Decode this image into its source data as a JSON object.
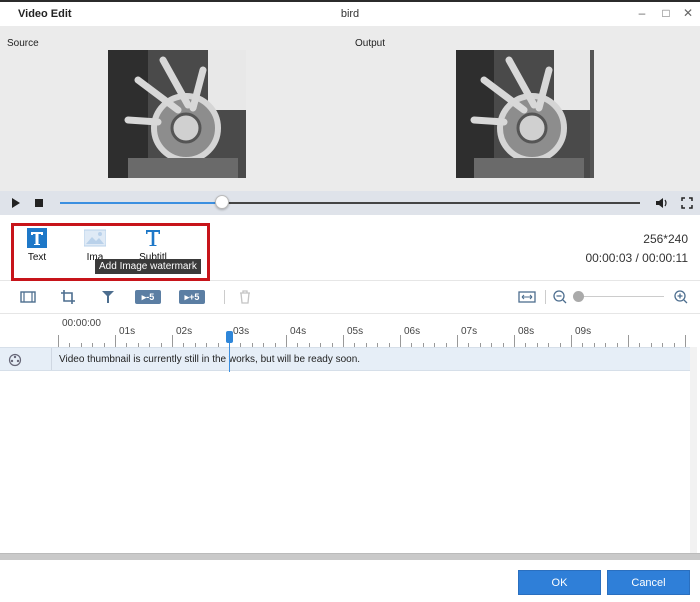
{
  "window": {
    "app_title": "Video Edit",
    "file_name": "bird",
    "minimize_icon": "minimize-icon",
    "maximize_icon": "maximize-icon",
    "close_icon": "close-icon"
  },
  "preview": {
    "source_label": "Source",
    "output_label": "Output"
  },
  "player": {
    "progress": 0.28,
    "play_icon": "play-icon",
    "stop_icon": "stop-icon",
    "volume_icon": "volume-icon",
    "fullscreen_icon": "fullscreen-icon"
  },
  "tools": {
    "items": [
      {
        "label": "Text",
        "icon": "text-icon"
      },
      {
        "label": "Ima",
        "icon": "image-icon"
      },
      {
        "label": "Subtitl",
        "icon": "subtitle-icon"
      }
    ],
    "tooltip": "Add Image watermark",
    "resolution": "256*240",
    "time": "00:00:03 / 00:00:11"
  },
  "edit_toolbar": {
    "icons": [
      "clip-icon",
      "crop-icon",
      "split-icon",
      "rewind-5-icon",
      "forward-5-icon",
      "delete-icon",
      "fit-icon",
      "zoom-out-icon",
      "zoom-in-icon"
    ],
    "rewind_label": "-5",
    "forward_label": "+5",
    "zoom_level": 0.0
  },
  "timeline": {
    "ticks": [
      "00:00:00",
      "01s",
      "02s",
      "03s",
      "04s",
      "05s",
      "06s",
      "07s",
      "08s",
      "09s"
    ],
    "track_message": "Video thumbnail is currently still in the works, but will be ready soon.",
    "track_icon": "film-reel-icon"
  },
  "footer": {
    "ok_label": "OK",
    "cancel_label": "Cancel"
  },
  "colors": {
    "accent": "#2f7fd8",
    "highlight": "#c7141a"
  }
}
